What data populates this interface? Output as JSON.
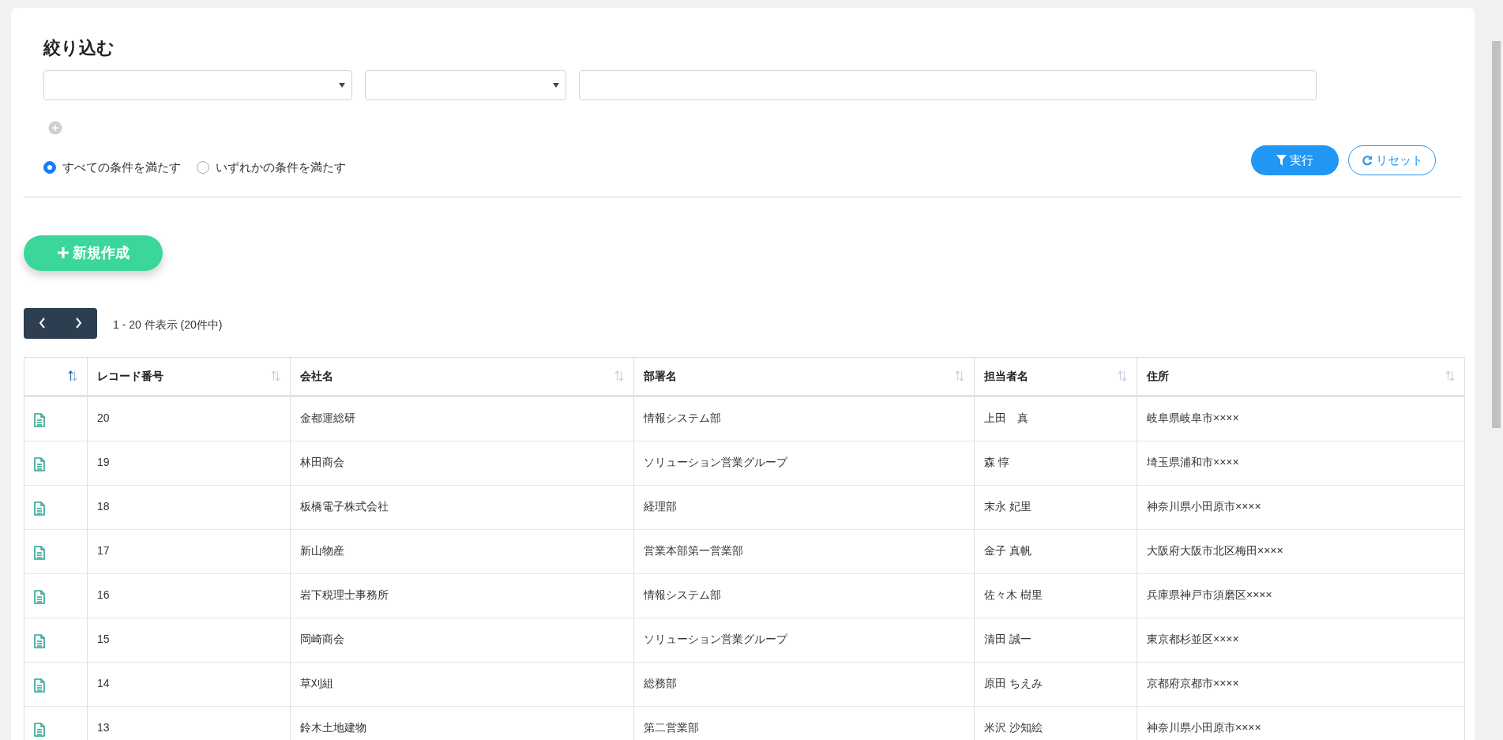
{
  "filter": {
    "title": "絞り込む",
    "conditions": [
      {
        "kind": "select"
      },
      {
        "kind": "select"
      },
      {
        "kind": "text"
      }
    ],
    "match_modes": [
      {
        "label": "すべての条件を満たす",
        "selected": true
      },
      {
        "label": "いずれかの条件を満たす",
        "selected": false
      }
    ],
    "run_button": "実行",
    "reset_button": "リセット"
  },
  "new_button": "新規作成",
  "pagination": {
    "summary": "1 - 20 件表示 (20件中)"
  },
  "table": {
    "columns": [
      {
        "sorted": true
      },
      {
        "label": "レコード番号",
        "sorted": false
      },
      {
        "label": "会社名",
        "sorted": false
      },
      {
        "label": "部署名",
        "sorted": false
      },
      {
        "label": "担当者名",
        "sorted": false
      },
      {
        "label": "住所",
        "sorted": false
      }
    ],
    "rows": [
      [
        "",
        "20",
        "金都運総研",
        "情報システム部",
        "上田　真",
        "岐阜県岐阜市××××"
      ],
      [
        "",
        "19",
        "林田商会",
        "ソリューション営業グループ",
        "森 惇",
        "埼玉県浦和市××××"
      ],
      [
        "",
        "18",
        "板橋電子株式会社",
        "経理部",
        "末永 妃里",
        "神奈川県小田原市××××"
      ],
      [
        "",
        "17",
        "新山物産",
        "営業本部第一営業部",
        "金子 真帆",
        "大阪府大阪市北区梅田××××"
      ],
      [
        "",
        "16",
        "岩下税理士事務所",
        "情報システム部",
        "佐々木 樹里",
        "兵庫県神戸市須磨区××××"
      ],
      [
        "",
        "15",
        "岡崎商会",
        "ソリューション営業グループ",
        "清田 誠一",
        "東京都杉並区××××"
      ],
      [
        "",
        "14",
        "草刈組",
        "総務部",
        "原田 ちえみ",
        "京都府京都市××××"
      ],
      [
        "",
        "13",
        "鈴木土地建物",
        "第二営業部",
        "米沢 沙知絵",
        "神奈川県小田原市××××"
      ]
    ]
  }
}
